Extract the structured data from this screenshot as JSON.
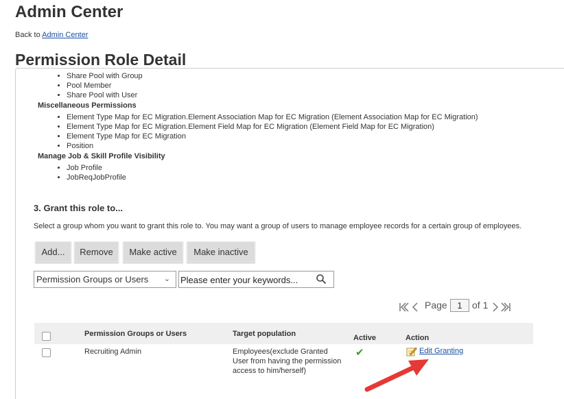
{
  "header": {
    "title": "Admin Center",
    "back_prefix": "Back to ",
    "back_link": "Admin Center",
    "subtitle": "Permission Role Detail"
  },
  "permissions": {
    "top_items": [
      "Share Pool with Group",
      "Pool Member",
      "Share Pool with User"
    ],
    "misc_label": "Miscellaneous Permissions",
    "misc_items": [
      "Element Type Map for EC Migration.Element Association Map for EC Migration (Element Association Map for EC Migration)",
      "Element Type Map for EC Migration.Element Field Map for EC Migration (Element Field Map for EC Migration)",
      "Element Type Map for EC Migration",
      "Position"
    ],
    "job_label": "Manage Job & Skill Profile Visibility",
    "job_items": [
      "Job Profile",
      "JobReqJobProfile"
    ]
  },
  "grant": {
    "title": "3. Grant this role to...",
    "description": "Select a group whom you want to grant this role to. You may want a group of users to manage employee records for a certain group of employees.",
    "buttons": {
      "add": "Add...",
      "remove": "Remove",
      "make_active": "Make active",
      "make_inactive": "Make inactive"
    },
    "filter_selected": "Permission Groups or Users",
    "search_placeholder": "Please enter your keywords...",
    "pager": {
      "page_label": "Page",
      "page_value": "1",
      "of_label": "of 1"
    }
  },
  "table": {
    "headers": {
      "group": "Permission Groups or Users",
      "target": "Target population",
      "active": "Active",
      "action": "Action"
    },
    "rows": [
      {
        "group": "Recruiting Admin",
        "target": "Employees(exclude Granted User from having the permission access to him/herself)",
        "active": "✔",
        "action": "Edit Granting"
      }
    ]
  },
  "colors": {
    "link": "#1a4fa0",
    "check": "#3a9a2a",
    "arrow": "#e53935",
    "header_bg": "#efefef"
  },
  "icons": [
    "search-icon",
    "first-page-icon",
    "prev-page-icon",
    "next-page-icon",
    "last-page-icon",
    "checkmark-icon",
    "edit-icon",
    "annotation-arrow"
  ]
}
